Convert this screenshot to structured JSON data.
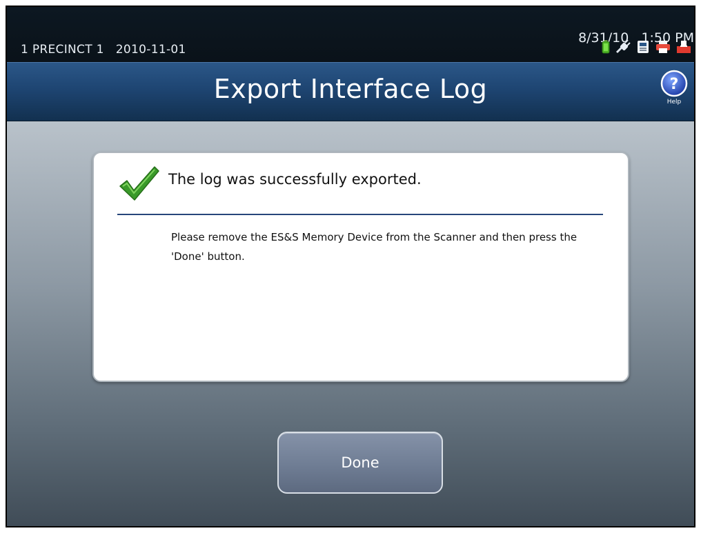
{
  "status_bar": {
    "precinct": "1 PRECINCT 1   2010-11-01",
    "date": "8/31/10",
    "time": "1:50 PM",
    "icons": [
      "battery-icon",
      "power-plug-icon",
      "memory-device-icon",
      "printer-icon",
      "ballot-box-icon"
    ]
  },
  "header": {
    "title": "Export Interface Log",
    "help_label": "Help"
  },
  "dialog": {
    "heading": "The log was successfully exported.",
    "message": "Please remove the ES&S Memory Device from the Scanner and then press the 'Done' button."
  },
  "actions": {
    "done_label": "Done"
  },
  "colors": {
    "title_bar": "#1e4572",
    "divider": "#27457a",
    "check": "#3a9a2a",
    "button": "#6f7d94"
  }
}
